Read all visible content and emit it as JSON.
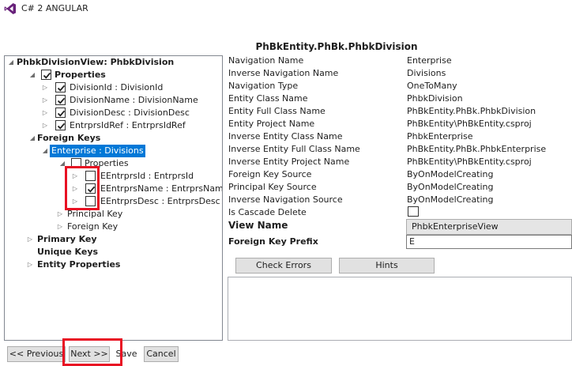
{
  "app": {
    "title": "C# 2 ANGULAR"
  },
  "entity_title": "PhBkEntity.PhBk.PhbkDivision",
  "tree": {
    "root": "PhbkDivisionView: PhbkDivision",
    "properties": "Properties",
    "props": [
      "DivisionId : DivisionId",
      "DivisionName : DivisionName",
      "DivisionDesc : DivisionDesc",
      "EntrprsIdRef : EntrprsIdRef"
    ],
    "foreign_keys": "Foreign Keys",
    "fk_selected": "Enterprise : Divisions",
    "fk_properties": "Properties",
    "fk_props": [
      "EEntrprsId : EntrprsId",
      "EEntrprsName : EntrprsName",
      "EEntrprsDesc : EntrprsDesc"
    ],
    "principal_key": "Principal Key",
    "foreign_key": "Foreign Key",
    "primary_key": "Primary Key",
    "unique_keys": "Unique Keys",
    "entity_properties": "Entity Properties"
  },
  "details": [
    {
      "label": "Navigation Name",
      "value": "Enterprise"
    },
    {
      "label": "Inverse Navigation Name",
      "value": "Divisions"
    },
    {
      "label": "Navigation Type",
      "value": "OneToMany"
    },
    {
      "label": "Entity Class Name",
      "value": "PhbkDivision"
    },
    {
      "label": "Entity Full Class Name",
      "value": "PhBkEntity.PhBk.PhbkDivision"
    },
    {
      "label": "Entity Project Name",
      "value": "PhBkEntity\\PhBkEntity.csproj"
    },
    {
      "label": "Inverse Entity Class Name",
      "value": "PhbkEnterprise"
    },
    {
      "label": "Inverse Entity Full Class Name",
      "value": "PhBkEntity.PhBk.PhbkEnterprise"
    },
    {
      "label": "Inverse Entity Project Name",
      "value": "PhBkEntity\\PhBkEntity.csproj"
    },
    {
      "label": "Foreign Key Source",
      "value": "ByOnModelCreating"
    },
    {
      "label": "Principal Key Source",
      "value": "ByOnModelCreating"
    },
    {
      "label": "Inverse Navigation Source",
      "value": "ByOnModelCreating"
    }
  ],
  "cascade_label": "Is Cascade Delete",
  "view_name_label": "View Name",
  "view_name_value": "PhbkEnterpriseView",
  "fk_prefix_label": "Foreign Key Prefix",
  "fk_prefix_value": "E",
  "buttons": {
    "check_errors": "Check Errors",
    "hints": "Hints",
    "previous": "<< Previous",
    "next": "Next >>",
    "save": "Save",
    "cancel": "Cancel"
  },
  "colors": {
    "selection": "#0078d7",
    "highlight_box": "#e81123",
    "vs_logo": "#68217a"
  }
}
